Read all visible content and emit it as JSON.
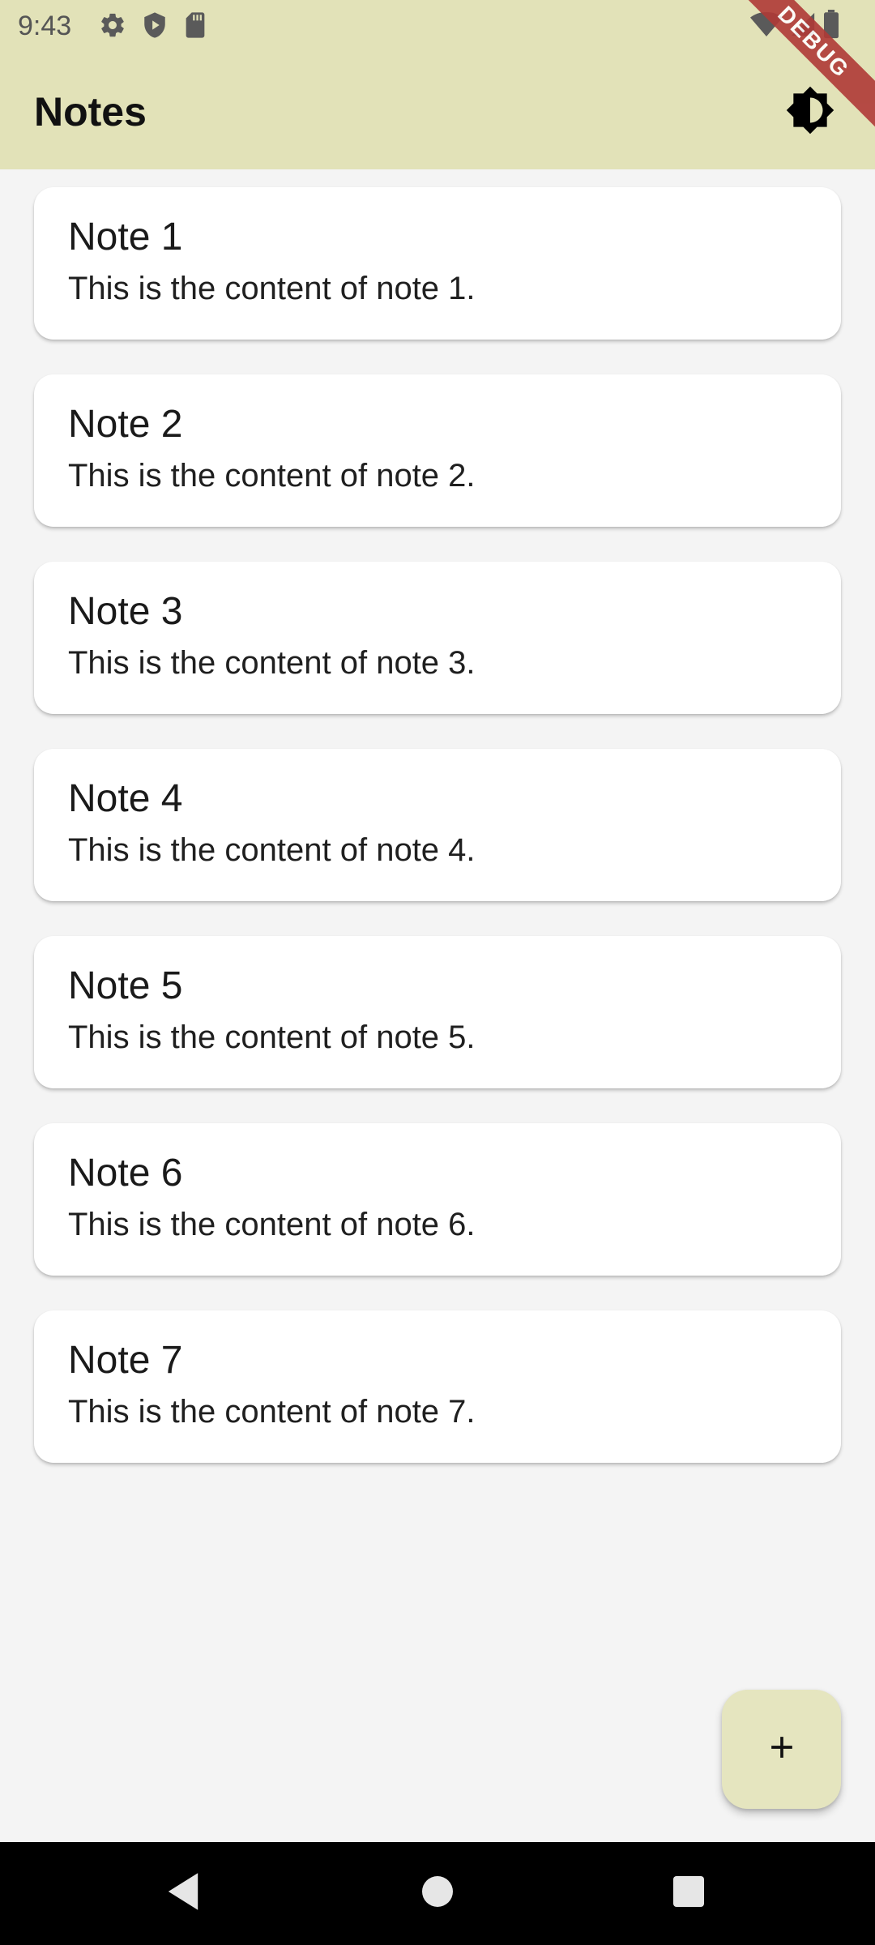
{
  "status_bar": {
    "time": "9:43",
    "icons_left": [
      "gear-icon",
      "shield-play-icon",
      "sd-card-icon"
    ],
    "icons_right": [
      "wifi-icon",
      "signal-icon",
      "battery-icon"
    ]
  },
  "app_bar": {
    "title": "Notes",
    "action_icon": "brightness-icon",
    "background": "#e2e2b8"
  },
  "debug_banner": {
    "label": "DEBUG",
    "color": "#b03a37"
  },
  "notes": [
    {
      "title": "Note 1",
      "content": "This is the content of note 1."
    },
    {
      "title": "Note 2",
      "content": "This is the content of note 2."
    },
    {
      "title": "Note 3",
      "content": "This is the content of note 3."
    },
    {
      "title": "Note 4",
      "content": "This is the content of note 4."
    },
    {
      "title": "Note 5",
      "content": "This is the content of note 5."
    },
    {
      "title": "Note 6",
      "content": "This is the content of note 6."
    },
    {
      "title": "Note 7",
      "content": "This is the content of note 7."
    }
  ],
  "fab": {
    "icon": "plus-icon",
    "background": "#e5e5bf"
  },
  "nav_bar": {
    "buttons": [
      "back-icon",
      "home-icon",
      "recents-icon"
    ]
  }
}
